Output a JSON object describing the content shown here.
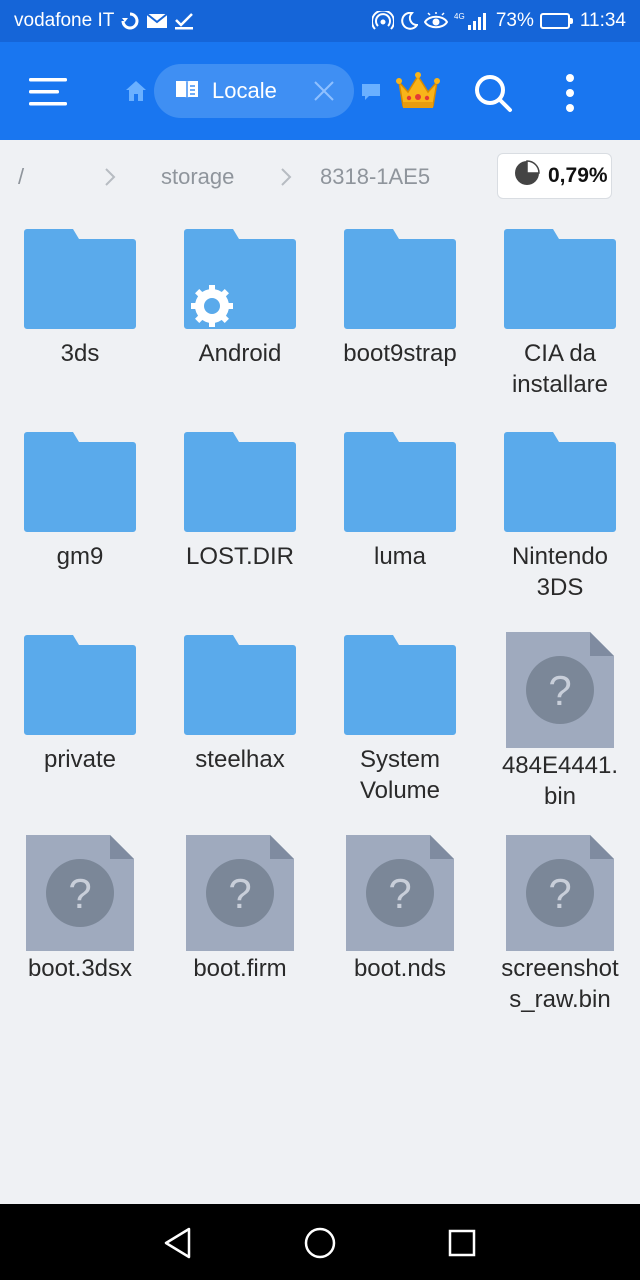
{
  "status_bar": {
    "carrier": "vodafone IT",
    "network": "4G",
    "battery_percent": "73%",
    "battery_level": 0.73,
    "time": "11:34",
    "icons": [
      "data-saver-icon",
      "mail-icon",
      "check-icon",
      "hotspot-icon",
      "moon-icon",
      "eye-icon",
      "signal-icon",
      "battery-icon"
    ]
  },
  "app_bar": {
    "tab_label": "Locale",
    "icons": [
      "menu-icon",
      "home-icon",
      "tab-icon",
      "close-icon",
      "crown-icon",
      "search-icon",
      "more-vert-icon"
    ],
    "accent": "#1976f0"
  },
  "breadcrumb": {
    "root": "/",
    "parts": [
      "storage",
      "8318-1AE5"
    ],
    "usage": "0,79%",
    "usage_fraction": 0.0079
  },
  "items": [
    {
      "name": "3ds",
      "type": "folder"
    },
    {
      "name": "Android",
      "type": "folder",
      "badge": "gear-icon"
    },
    {
      "name": "boot9strap",
      "type": "folder"
    },
    {
      "name": "CIA da installare",
      "type": "folder"
    },
    {
      "name": "gm9",
      "type": "folder"
    },
    {
      "name": "LOST.DIR",
      "type": "folder"
    },
    {
      "name": "luma",
      "type": "folder"
    },
    {
      "name": "Nintendo 3DS",
      "type": "folder"
    },
    {
      "name": "private",
      "type": "folder"
    },
    {
      "name": "steelhax",
      "type": "folder"
    },
    {
      "name": "System Volume",
      "type": "folder"
    },
    {
      "name": "484E4441.bin",
      "type": "file"
    },
    {
      "name": "boot.3dsx",
      "type": "file"
    },
    {
      "name": "boot.firm",
      "type": "file"
    },
    {
      "name": "boot.nds",
      "type": "file"
    },
    {
      "name": "screenshots_raw.bin",
      "type": "file"
    }
  ],
  "colors": {
    "folder": "#5aaaeb",
    "file": "#9faabe",
    "file_fold": "#7f8ba0",
    "file_circle": "#7b8798"
  },
  "nav_bar": {
    "icons": [
      "back-icon",
      "home-circle-icon",
      "recents-icon"
    ]
  }
}
